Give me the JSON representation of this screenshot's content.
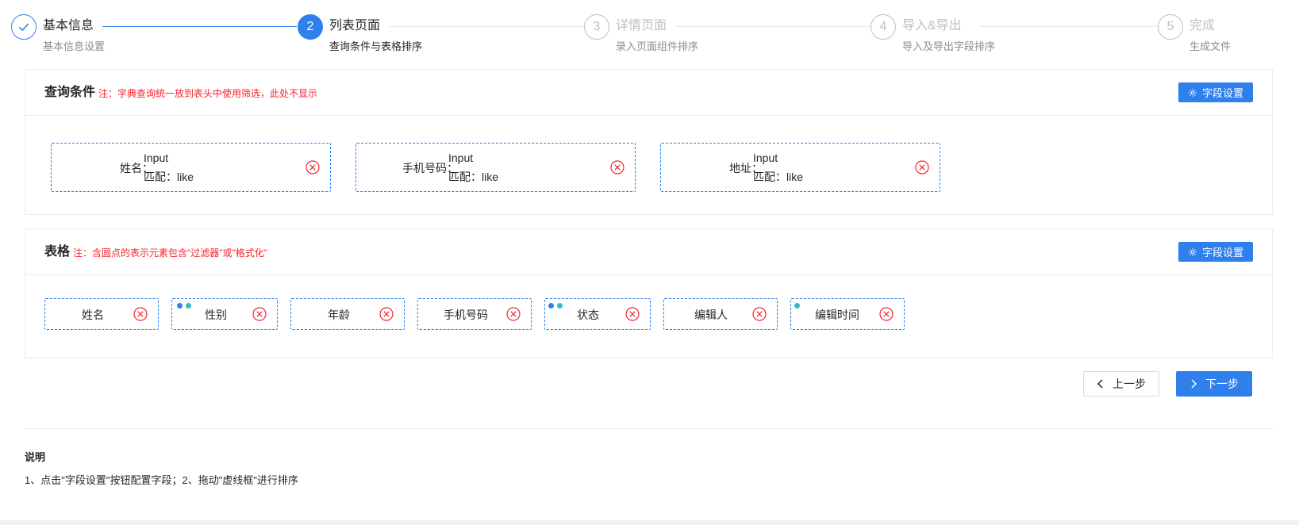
{
  "steps": [
    {
      "number": "1",
      "title": "基本信息",
      "desc": "基本信息设置",
      "status": "done"
    },
    {
      "number": "2",
      "title": "列表页面",
      "desc": "查询条件与表格排序",
      "status": "active"
    },
    {
      "number": "3",
      "title": "详情页面",
      "desc": "录入页面组件排序",
      "status": "wait"
    },
    {
      "number": "4",
      "title": "导入&导出",
      "desc": "导入及导出字段排序",
      "status": "wait"
    },
    {
      "number": "5",
      "title": "完成",
      "desc": "生成文件",
      "status": "wait"
    }
  ],
  "query": {
    "title": "查询条件",
    "note": "注：字典查询统一放到表头中使用筛选，此处不显示",
    "field_button": "字段设置",
    "items": [
      {
        "label": "姓名：",
        "type": "Input",
        "match": "匹配：like"
      },
      {
        "label": "手机号码：",
        "type": "Input",
        "match": "匹配：like"
      },
      {
        "label": "地址：",
        "type": "Input",
        "match": "匹配：like"
      }
    ]
  },
  "table": {
    "title": "表格",
    "note": "注：含圆点的表示元素包含\"过滤器\"或\"格式化\"",
    "field_button": "字段设置",
    "columns": [
      {
        "label": "姓名",
        "dots": []
      },
      {
        "label": "性别",
        "dots": [
          "#2f80ed",
          "#36b8c9"
        ]
      },
      {
        "label": "年龄",
        "dots": []
      },
      {
        "label": "手机号码",
        "dots": []
      },
      {
        "label": "状态",
        "dots": [
          "#2f80ed",
          "#36b8c9"
        ]
      },
      {
        "label": "编辑人",
        "dots": []
      },
      {
        "label": "编辑时间",
        "dots": [
          "#36b8c9"
        ]
      }
    ]
  },
  "nav": {
    "prev_label": "上一步",
    "next_label": "下一步"
  },
  "description": {
    "title": "说明",
    "text": "1、点击\"字段设置\"按钮配置字段；2、拖动\"虚线框\"进行排序"
  },
  "colors": {
    "primary": "#2f80ed",
    "danger": "#f5222d",
    "dot_blue": "#2f80ed",
    "dot_teal": "#36b8c9"
  }
}
